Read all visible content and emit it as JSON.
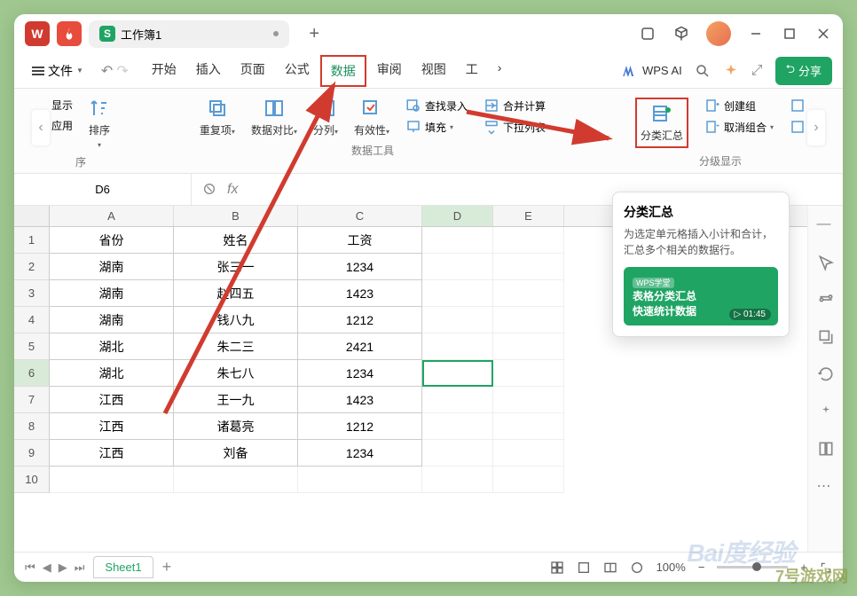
{
  "title": {
    "workbook": "工作簿1"
  },
  "menu": {
    "file": "文件",
    "tabs": [
      "开始",
      "插入",
      "页面",
      "公式",
      "数据",
      "审阅",
      "视图",
      "工"
    ],
    "active": "数据",
    "more": "›"
  },
  "ai": {
    "label": "WPS AI"
  },
  "share": {
    "label": "分享"
  },
  "ribbon": {
    "g0": {
      "show": "显示",
      "apply": "应用",
      "sort": "排序",
      "label": "序"
    },
    "g1": {
      "dup": "重复项",
      "cmp": "数据对比",
      "split": "分列",
      "valid": "有效性",
      "find": "查找录入",
      "fill": "填充",
      "merge": "合并计算",
      "dropdown": "下拉列表",
      "label": "数据工具"
    },
    "g2": {
      "subtotal": "分类汇总",
      "group": "创建组",
      "ungroup": "取消组合",
      "label": "分级显示"
    }
  },
  "formula_bar": {
    "cell_ref": "D6",
    "fx": "fx"
  },
  "grid": {
    "cols": [
      "A",
      "B",
      "C",
      "D",
      "E"
    ],
    "headers": [
      "省份",
      "姓名",
      "工资"
    ],
    "rows": [
      {
        "n": "1",
        "p": "省份",
        "x": "姓名",
        "w": "工资",
        "hdr": true
      },
      {
        "n": "2",
        "p": "湖南",
        "x": "张三一",
        "w": "1234"
      },
      {
        "n": "3",
        "p": "湖南",
        "x": "赵四五",
        "w": "1423"
      },
      {
        "n": "4",
        "p": "湖南",
        "x": "钱八九",
        "w": "1212"
      },
      {
        "n": "5",
        "p": "湖北",
        "x": "朱二三",
        "w": "2421"
      },
      {
        "n": "6",
        "p": "湖北",
        "x": "朱七八",
        "w": "1234",
        "sel": true
      },
      {
        "n": "7",
        "p": "江西",
        "x": "王一九",
        "w": "1423"
      },
      {
        "n": "8",
        "p": "江西",
        "x": "诸葛亮",
        "w": "1212"
      },
      {
        "n": "9",
        "p": "江西",
        "x": "刘备",
        "w": "1234"
      },
      {
        "n": "10",
        "p": "",
        "x": "",
        "w": "",
        "empty": true
      }
    ]
  },
  "tooltip": {
    "title": "分类汇总",
    "body": "为选定单元格插入小计和合计，汇总多个相关的数据行。",
    "card_badge": "WPS学堂",
    "card_line1": "表格分类汇总",
    "card_line2": "快速统计数据",
    "duration": "01:45"
  },
  "status": {
    "sheet": "Sheet1",
    "zoom": "100%"
  },
  "watermark": {
    "site": "7号游戏网",
    "baidu": "Bai"
  }
}
